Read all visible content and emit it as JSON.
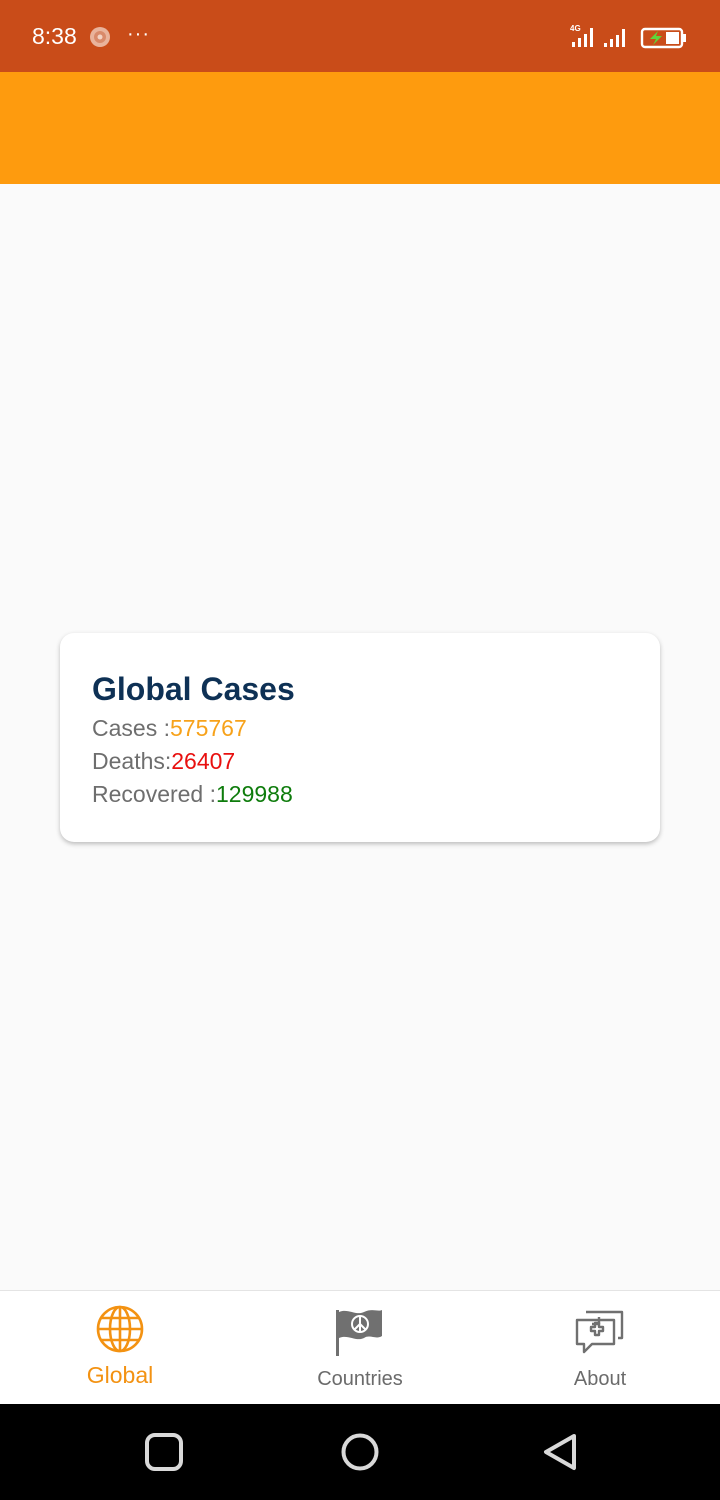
{
  "status_bar": {
    "time": "8:38",
    "overflow": "···",
    "network": "4G",
    "background_color": "#c94c19"
  },
  "app_bar": {
    "background_color": "#fe9b0e"
  },
  "card": {
    "title": "Global Cases",
    "cases_label": "Cases :",
    "cases_value": "575767",
    "deaths_label": "Deaths:",
    "deaths_value": "26407",
    "recovered_label": "Recovered :",
    "recovered_value": "129988",
    "colors": {
      "title": "#0e3155",
      "cases": "#f7a21a",
      "deaths": "#e8100f",
      "recovered": "#0e7c0c"
    }
  },
  "bottom_nav": {
    "items": [
      {
        "label": "Global",
        "icon": "globe-icon",
        "active": true
      },
      {
        "label": "Countries",
        "icon": "flag-icon",
        "active": false
      },
      {
        "label": "About",
        "icon": "medical-chat-icon",
        "active": false
      }
    ],
    "active_color": "#f39212"
  },
  "system_nav": {
    "buttons": [
      "recents-icon",
      "home-icon",
      "back-icon"
    ]
  }
}
